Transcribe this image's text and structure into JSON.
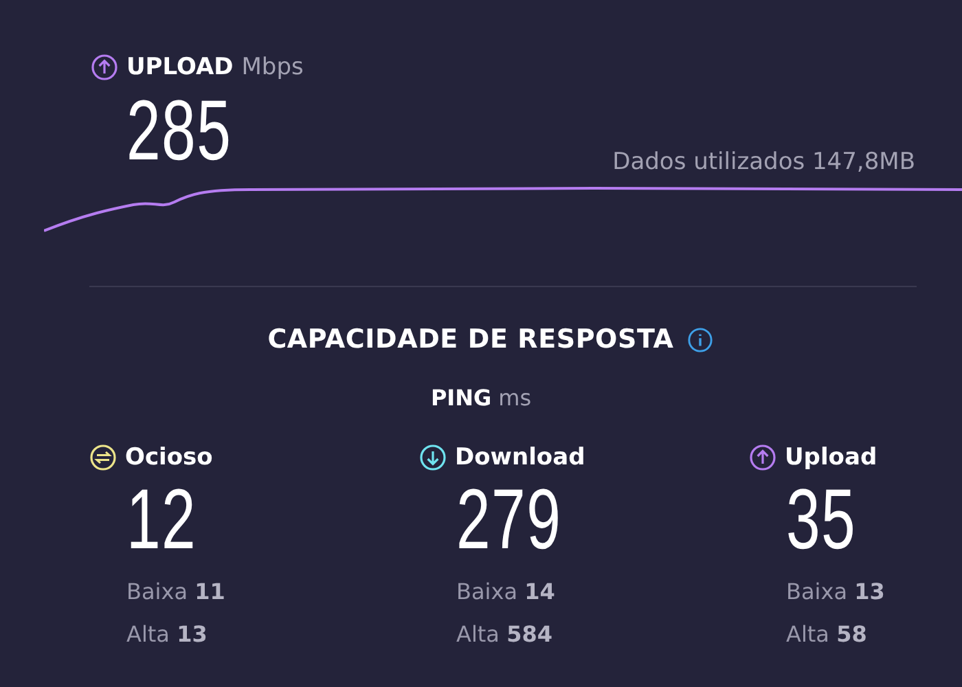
{
  "upload": {
    "label": "UPLOAD",
    "unit": "Mbps",
    "value": "285",
    "data_used": "Dados utilizados 147,8MB"
  },
  "responsiveness": {
    "title": "CAPACIDADE DE RESPOSTA",
    "ping_label": "PING",
    "ping_unit": "ms",
    "metrics": [
      {
        "kind": "idle",
        "label": "Ocioso",
        "value": "12",
        "low_label": "Baixa",
        "low": "11",
        "high_label": "Alta",
        "high": "13"
      },
      {
        "kind": "download",
        "label": "Download",
        "value": "279",
        "low_label": "Baixa",
        "low": "14",
        "high_label": "Alta",
        "high": "584"
      },
      {
        "kind": "upload",
        "label": "Upload",
        "value": "35",
        "low_label": "Baixa",
        "low": "13",
        "high_label": "Alta",
        "high": "58"
      }
    ]
  }
}
